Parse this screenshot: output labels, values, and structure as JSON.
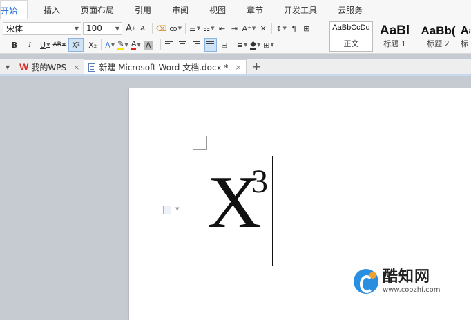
{
  "menu": {
    "items": [
      "开始",
      "插入",
      "页面布局",
      "引用",
      "审阅",
      "视图",
      "章节",
      "开发工具",
      "云服务"
    ],
    "active_index": 0
  },
  "toolbar": {
    "font_name": "宋体",
    "font_size": "100",
    "grow_font": "A",
    "shrink_font": "A",
    "bold": "B",
    "italic": "I",
    "underline": "U",
    "strikethrough": "AB",
    "superscript": "X²",
    "subscript": "X₂",
    "text_effect": "A",
    "font_color": "A",
    "char_shading": "A",
    "superscript_active": true
  },
  "styles": [
    {
      "preview": "AaBbCcDd",
      "name": "正文"
    },
    {
      "preview": "AaBl",
      "name": "标题 1"
    },
    {
      "preview": "AaBb(",
      "name": "标题 2"
    },
    {
      "preview": "Aa",
      "name": "标"
    }
  ],
  "tabs": [
    {
      "label": "我的WPS",
      "close": "×"
    },
    {
      "label": "新建 Microsoft Word 文档.docx *",
      "close": "×"
    }
  ],
  "add_tab": "+",
  "document": {
    "base": "X",
    "exponent": "3"
  },
  "watermark": {
    "name": "酷知网",
    "url": "www.coozhi.com"
  },
  "colors": {
    "accent": "#1e6bd6",
    "ribbon_bg": "#f7f7f7",
    "workspace_bg": "#c6cad1",
    "page_bg": "#ffffff",
    "wps_red": "#d9302b"
  },
  "icons": {
    "app_logo": "wps-logo-icon",
    "doc": "word-doc-icon",
    "paragraph_handle": "paragraph-handle-icon"
  }
}
